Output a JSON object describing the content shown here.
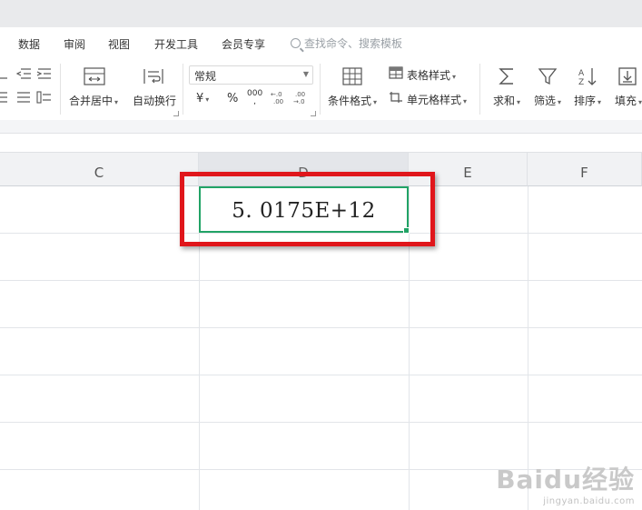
{
  "menu": {
    "items": [
      "数据",
      "审阅",
      "视图",
      "开发工具",
      "会员专享"
    ],
    "search_placeholder": "查找命令、搜索模板"
  },
  "ribbon": {
    "merge_center": "合并居中",
    "wrap_text": "自动换行",
    "number_format": "常规",
    "currency_symbol": "¥",
    "percent_symbol": "%",
    "thousands_symbol": "000",
    "cond_format": "条件格式",
    "table_style": "表格样式",
    "cell_style": "单元格样式",
    "sum": "求和",
    "filter": "筛选",
    "sort": "排序",
    "fill": "填充"
  },
  "columns": [
    "C",
    "D",
    "E",
    "F"
  ],
  "cell": {
    "value": "5. 0175E+12",
    "highlight_color": "#e0161b",
    "active_border_color": "#21a366"
  },
  "watermark": {
    "logo": "Baidu经验",
    "url": "jingyan.baidu.com"
  }
}
